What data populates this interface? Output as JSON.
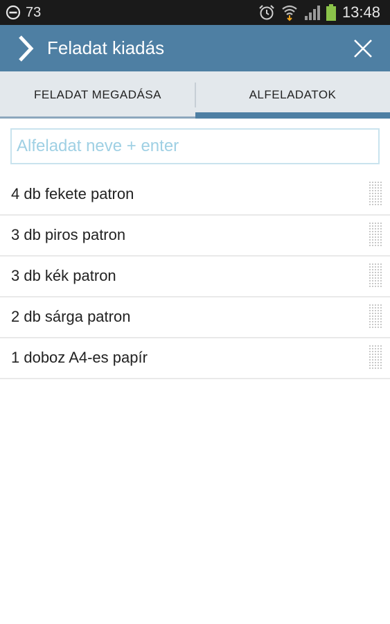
{
  "status_bar": {
    "notification_count": "73",
    "time": "13:48",
    "icons": [
      "do-not-disturb-icon",
      "alarm-icon",
      "wifi-icon",
      "signal-icon",
      "battery-icon"
    ]
  },
  "app_bar": {
    "title": "Feladat kiadás",
    "back_icon": "chevron-right-icon",
    "close_icon": "close-icon",
    "color": "#4e7fa3"
  },
  "tabs": [
    {
      "label": "FELADAT MEGADÁSA",
      "active": false
    },
    {
      "label": "ALFELADATOK",
      "active": true
    }
  ],
  "subtask_input": {
    "placeholder": "Alfeladat neve + enter",
    "value": ""
  },
  "subtasks": [
    {
      "label": "4 db fekete patron"
    },
    {
      "label": "3 db piros patron"
    },
    {
      "label": "3 db kék patron"
    },
    {
      "label": "2 db sárga patron"
    },
    {
      "label": "1 doboz A4-es papír"
    }
  ],
  "colors": {
    "accent": "#4e7fa3",
    "input_border": "#c9e3ee",
    "placeholder": "#9fd0e4",
    "status_bar": "#1a1a1a"
  }
}
